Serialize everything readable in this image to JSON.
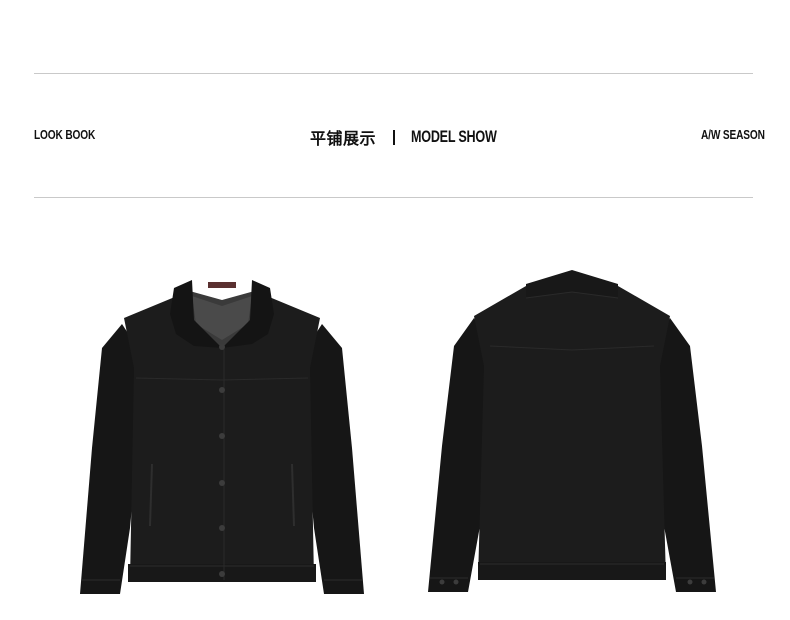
{
  "header": {
    "left_label": "LOOK BOOK",
    "center_cn": "平铺展示",
    "center_en": "MODEL SHOW",
    "right_label": "A/W SEASON"
  },
  "products": [
    {
      "view": "front",
      "icon": "jacket-front-image"
    },
    {
      "view": "back",
      "icon": "jacket-back-image"
    }
  ],
  "colors": {
    "jacket": "#1b1b1b",
    "rule": "#c9c9c9",
    "text": "#111111"
  }
}
